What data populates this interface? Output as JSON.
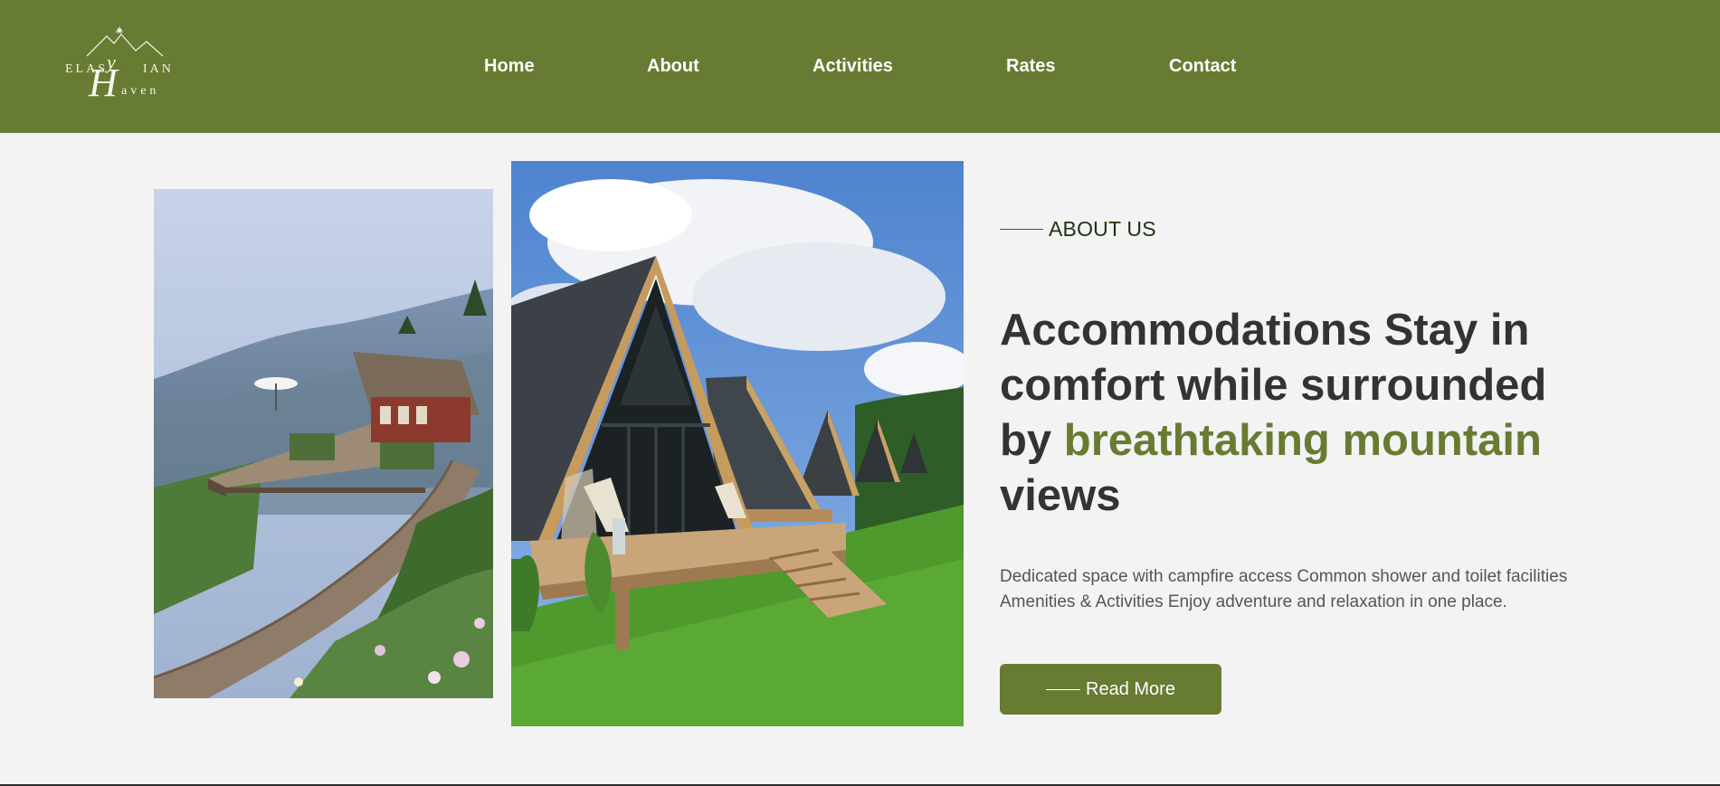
{
  "header": {
    "logo": {
      "top_text": "ELAS",
      "right_text": "IAN",
      "script_letter_y": "y",
      "script_letter_h": "H",
      "bottom_text": "aven"
    },
    "nav": [
      {
        "label": "Home"
      },
      {
        "label": "About"
      },
      {
        "label": "Activities"
      },
      {
        "label": "Rates"
      },
      {
        "label": "Contact"
      }
    ]
  },
  "about": {
    "eyebrow": "ABOUT US",
    "headline_part1": "Accommodations Stay in comfort while surrounded by ",
    "headline_accent": "breathtaking mountain",
    "headline_part2": " views",
    "description": "Dedicated space with campfire access Common shower and toilet facilities Amenities & Activities Enjoy adventure and relaxation in one place.",
    "button_label": "Read More"
  },
  "colors": {
    "brand_green": "#687b32",
    "background": "#f3f3f3",
    "heading_text": "#333333",
    "body_text": "#555555"
  }
}
